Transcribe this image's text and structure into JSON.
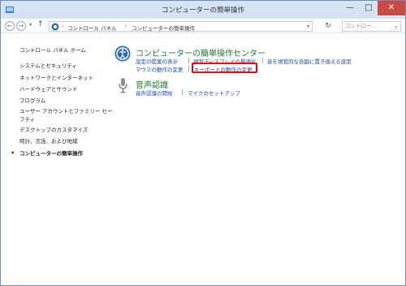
{
  "window": {
    "title": "コンピューターの簡単操作",
    "minimize": "—",
    "maximize": "□",
    "close": "✕"
  },
  "address_bar": {
    "back_glyph": "←",
    "forward_glyph": "→",
    "recent_glyph": "▾",
    "up_glyph": "↑",
    "breadcrumbs": [
      "コントロール パネル",
      "コンピューターの簡単操作"
    ],
    "separator": "›",
    "dropdown_glyph": "▾",
    "refresh_glyph": "↻",
    "search_placeholder": "コントロー...",
    "search_glyph": "⌕"
  },
  "sidebar": {
    "home": "コントロール パネル ホーム",
    "items": [
      "システムとセキュリティ",
      "ネットワークとインターネット",
      "ハードウェアとサウンド",
      "プログラム",
      "ユーザー アカウントとファミリー セー",
      "フティ",
      "デスクトップのカスタマイズ",
      "時計、言語、および地域",
      "コンピューターの簡単操作"
    ],
    "current_bullet": "•"
  },
  "sections": {
    "ease": {
      "heading": "コンピューターの簡単操作センター",
      "links": [
        "設定の提案の表示",
        "視覚ディスプレイの最適化",
        "音を視覚的な合図に置き換える設定",
        "マウスの動作の変更",
        "キーボードの動作の変更"
      ]
    },
    "speech": {
      "heading": "音声認識",
      "links": [
        "音声認識の開始",
        "マイクのセットアップ"
      ]
    }
  },
  "colors": {
    "heading_green": "#1f7a33",
    "link_blue": "#1a49a6",
    "highlight_red": "#e0000e",
    "close_red": "#c94a45"
  }
}
